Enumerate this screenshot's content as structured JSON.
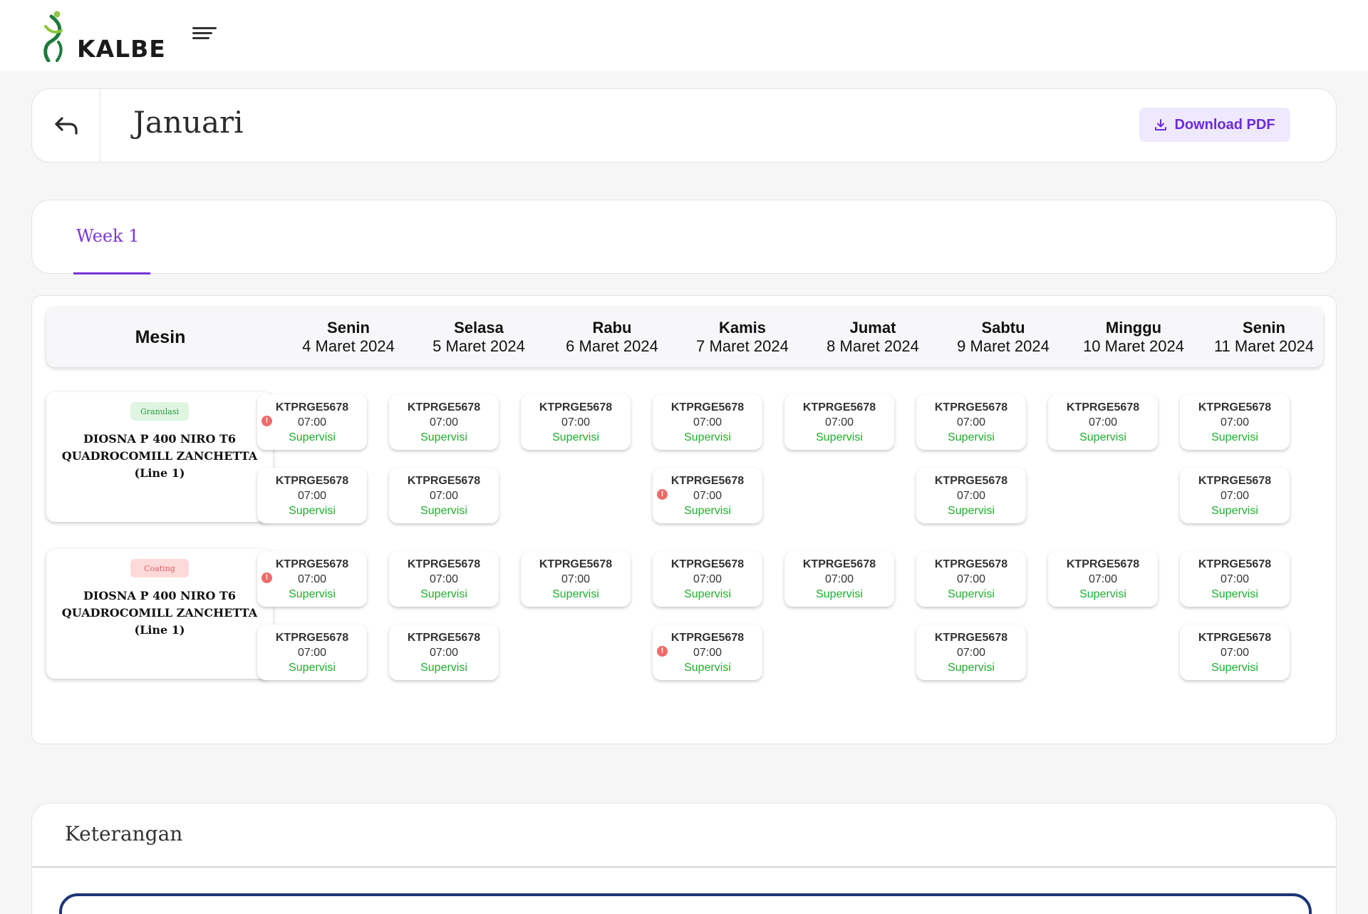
{
  "brand": {
    "name": "KALBE"
  },
  "header": {
    "title": "Januari",
    "download_label": "Download PDF"
  },
  "tabs": [
    {
      "label": "Week 1",
      "active": true
    }
  ],
  "schedule": {
    "mesin_label": "Mesin",
    "days": [
      {
        "name": "Senin",
        "date": "4 Maret 2024"
      },
      {
        "name": "Selasa",
        "date": "5 Maret 2024"
      },
      {
        "name": "Rabu",
        "date": "6 Maret 2024"
      },
      {
        "name": "Kamis",
        "date": "7 Maret 2024"
      },
      {
        "name": "Jumat",
        "date": "8 Maret 2024"
      },
      {
        "name": "Sabtu",
        "date": "9 Maret 2024"
      },
      {
        "name": "Minggu",
        "date": "10 Maret 2024"
      },
      {
        "name": "Senin",
        "date": "11 Maret 2024"
      }
    ],
    "machines": [
      {
        "badge": "Granulasi",
        "badge_type": "green",
        "name": "DIOSNA P 400 NIRO T6 QUADROCOMILL ZANCHETTA (Line 1)",
        "slots": [
          [
            {
              "code": "KTPRGE5678",
              "time": "07:00",
              "status": "Supervisi",
              "alert": true
            },
            {
              "code": "KTPRGE5678",
              "time": "07:00",
              "status": "Supervisi",
              "alert": false
            }
          ],
          [
            {
              "code": "KTPRGE5678",
              "time": "07:00",
              "status": "Supervisi",
              "alert": false
            },
            {
              "code": "KTPRGE5678",
              "time": "07:00",
              "status": "Supervisi",
              "alert": false
            }
          ],
          [
            {
              "code": "KTPRGE5678",
              "time": "07:00",
              "status": "Supervisi",
              "alert": false
            }
          ],
          [
            {
              "code": "KTPRGE5678",
              "time": "07:00",
              "status": "Supervisi",
              "alert": false
            },
            {
              "code": "KTPRGE5678",
              "time": "07:00",
              "status": "Supervisi",
              "alert": true
            }
          ],
          [
            {
              "code": "KTPRGE5678",
              "time": "07:00",
              "status": "Supervisi",
              "alert": false
            }
          ],
          [
            {
              "code": "KTPRGE5678",
              "time": "07:00",
              "status": "Supervisi",
              "alert": false
            },
            {
              "code": "KTPRGE5678",
              "time": "07:00",
              "status": "Supervisi",
              "alert": false
            }
          ],
          [
            {
              "code": "KTPRGE5678",
              "time": "07:00",
              "status": "Supervisi",
              "alert": false
            }
          ],
          [
            {
              "code": "KTPRGE5678",
              "time": "07:00",
              "status": "Supervisi",
              "alert": false
            },
            {
              "code": "KTPRGE5678",
              "time": "07:00",
              "status": "Supervisi",
              "alert": false
            }
          ]
        ]
      },
      {
        "badge": "Coating",
        "badge_type": "red",
        "name": "DIOSNA P 400 NIRO T6 QUADROCOMILL ZANCHETTA (Line 1)",
        "slots": [
          [
            {
              "code": "KTPRGE5678",
              "time": "07:00",
              "status": "Supervisi",
              "alert": true
            },
            {
              "code": "KTPRGE5678",
              "time": "07:00",
              "status": "Supervisi",
              "alert": false
            }
          ],
          [
            {
              "code": "KTPRGE5678",
              "time": "07:00",
              "status": "Supervisi",
              "alert": false
            },
            {
              "code": "KTPRGE5678",
              "time": "07:00",
              "status": "Supervisi",
              "alert": false
            }
          ],
          [
            {
              "code": "KTPRGE5678",
              "time": "07:00",
              "status": "Supervisi",
              "alert": false
            }
          ],
          [
            {
              "code": "KTPRGE5678",
              "time": "07:00",
              "status": "Supervisi",
              "alert": false
            },
            {
              "code": "KTPRGE5678",
              "time": "07:00",
              "status": "Supervisi",
              "alert": true
            }
          ],
          [
            {
              "code": "KTPRGE5678",
              "time": "07:00",
              "status": "Supervisi",
              "alert": false
            }
          ],
          [
            {
              "code": "KTPRGE5678",
              "time": "07:00",
              "status": "Supervisi",
              "alert": false
            },
            {
              "code": "KTPRGE5678",
              "time": "07:00",
              "status": "Supervisi",
              "alert": false
            }
          ],
          [
            {
              "code": "KTPRGE5678",
              "time": "07:00",
              "status": "Supervisi",
              "alert": false
            }
          ],
          [
            {
              "code": "KTPRGE5678",
              "time": "07:00",
              "status": "Supervisi",
              "alert": false
            },
            {
              "code": "KTPRGE5678",
              "time": "07:00",
              "status": "Supervisi",
              "alert": false
            }
          ]
        ]
      }
    ]
  },
  "legend": {
    "title": "Keterangan"
  },
  "colors": {
    "accent": "#7b35d6",
    "status_green": "#1fae2b",
    "alert_red": "#f06a6a",
    "legend_border": "#1d3579"
  },
  "icons": {
    "back": "back-arrow-icon",
    "download": "download-icon",
    "menu": "hamburger-icon",
    "alert": "alert-icon"
  }
}
